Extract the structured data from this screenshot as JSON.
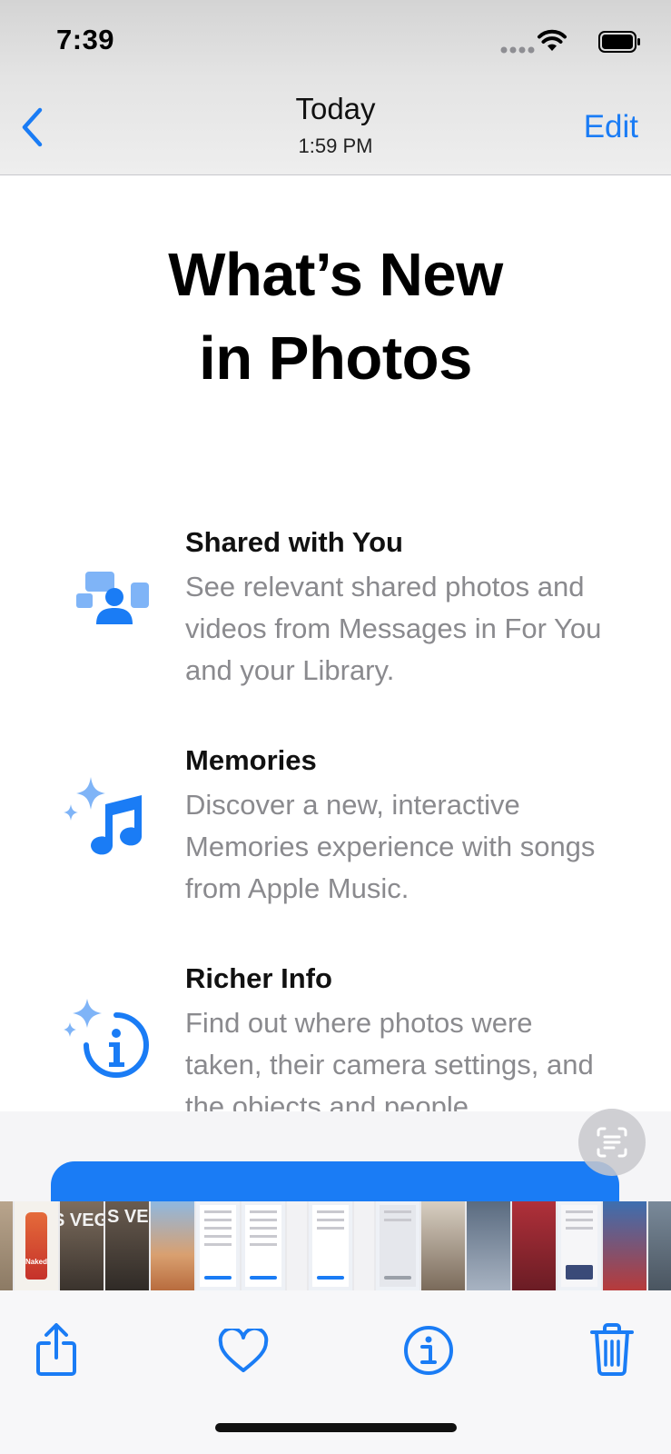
{
  "status_bar": {
    "time": "7:39"
  },
  "nav": {
    "title": "Today",
    "subtitle": "1:59 PM",
    "edit_label": "Edit",
    "back_icon": "chevron-left-icon"
  },
  "photo": {
    "headline": "What’s New\nin Photos",
    "features": [
      {
        "title": "Shared with You",
        "description": "See relevant shared photos and videos from Messages in For You and your Library.",
        "icon": "shared-with-you-icon"
      },
      {
        "title": "Memories",
        "description": "Discover a new, interactive Memories experience with songs from Apple Music.",
        "icon": "music-note-sparkle-icon"
      },
      {
        "title": "Richer Info",
        "description": "Find out where photos were taken, their camera settings, and the objects and people",
        "icon": "info-sparkle-icon"
      }
    ]
  },
  "colors": {
    "accent": "#1a7cf5",
    "secondary_text": "#8a8a8e"
  },
  "thumbnails": {
    "texts": [
      "S VEG",
      "S VEG",
      "Naked"
    ]
  },
  "toolbar": {
    "share_icon": "share-icon",
    "favorite_icon": "heart-icon",
    "info_icon": "info-icon",
    "delete_icon": "trash-icon"
  }
}
